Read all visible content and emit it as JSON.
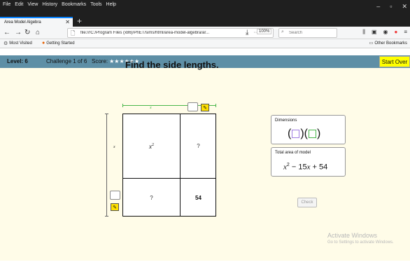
{
  "browser": {
    "menu": [
      "File",
      "Edit",
      "View",
      "History",
      "Bookmarks",
      "Tools",
      "Help"
    ],
    "window_controls": [
      "–",
      "▫",
      "✕"
    ],
    "tab_title": "Area Model Algebra",
    "tab_close": "✕",
    "newtab": "+",
    "url": "file:///C:/Program Files (x86)/PhET/sims/html/area-model-algebra/ar...",
    "url_tools": "···  ♡  ☆",
    "zoom": "100%",
    "search_placeholder": "Search",
    "bookmarks": [
      "Most Visited",
      "Getting Started"
    ],
    "other_bookmarks": "Other Bookmarks"
  },
  "sim": {
    "level": "Level: 6",
    "challenge": "Challenge 1 of 6",
    "score_label": "Score:",
    "stars": "★★★★★★",
    "start_over": "Start Over",
    "prompt": "Find the side lengths.",
    "top_dim_label": "x",
    "left_dim_label": "x",
    "edit_icon_glyph": "✎",
    "cells": {
      "top_left_var": "x",
      "top_left_exp": "2",
      "top_right": "?",
      "bottom_left": "?",
      "bottom_right": "54"
    },
    "dimensions_title": "Dimensions",
    "dims_paren_open": "(",
    "dims_paren_mid": ")(",
    "dims_paren_close": ")",
    "area_title": "Total area of model",
    "area_expr_var": "x",
    "area_expr_exp": "2",
    "area_expr_mid": " − 15",
    "area_expr_var2": "x",
    "area_expr_end": " + 54",
    "check": "Check",
    "colors": {
      "header": "#5e8fa6",
      "body": "#fffce8",
      "accent_yellow": "#ffff00",
      "green": "#49b64b",
      "purple": "#a07ee0"
    }
  },
  "watermark": {
    "line1": "Activate Windows",
    "line2": "Go to Settings to activate Windows."
  }
}
